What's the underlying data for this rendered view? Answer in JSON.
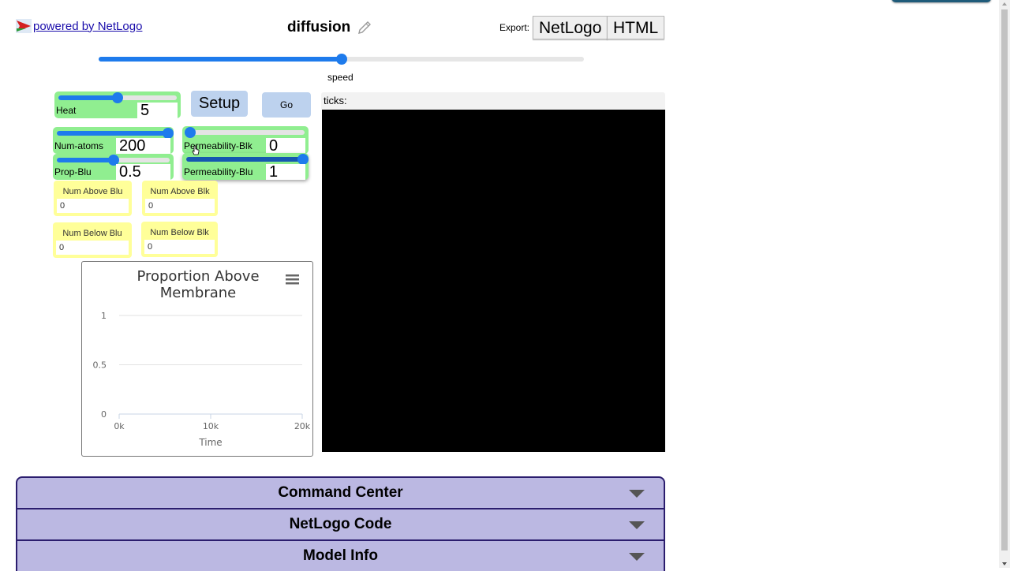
{
  "header": {
    "powered_by": "powered by NetLogo",
    "model_title": "diffusion",
    "export_label": "Export:",
    "export_buttons": [
      "NetLogo",
      "HTML"
    ]
  },
  "speed": {
    "label": "speed",
    "value_fraction": 0.5
  },
  "buttons": {
    "setup": "Setup",
    "go": "Go"
  },
  "sliders": {
    "heat": {
      "label": "Heat",
      "value": "5",
      "fraction": 0.5
    },
    "num_atoms": {
      "label": "Num-atoms",
      "value": "200",
      "fraction": 1.0
    },
    "prop_blu": {
      "label": "Prop-Blu",
      "value": "0.5",
      "fraction": 0.5
    },
    "permeability_blk": {
      "label": "Permeability-Blk",
      "value": "0",
      "fraction": 0.0
    },
    "permeability_blu": {
      "label": "Permeability-Blu",
      "value": "1",
      "fraction": 1.0
    }
  },
  "monitors": [
    {
      "label": "Num Above Blu",
      "value": "0"
    },
    {
      "label": "Num Above Blk",
      "value": "0"
    },
    {
      "label": "Num Below Blu",
      "value": "0"
    },
    {
      "label": "Num Below Blk",
      "value": "0"
    }
  ],
  "view": {
    "ticks_label": "ticks:",
    "background": "#000000"
  },
  "chart_data": {
    "type": "line",
    "title_lines": [
      "Proportion Above",
      "Membrane"
    ],
    "xlabel": "Time",
    "ylabel": "",
    "x_ticks": [
      "0k",
      "10k",
      "20k"
    ],
    "y_ticks": [
      "0",
      "0.5",
      "1"
    ],
    "xlim": [
      0,
      20000
    ],
    "ylim": [
      0,
      1
    ],
    "grid": true,
    "series": []
  },
  "tabs": [
    "Command Center",
    "NetLogo Code",
    "Model Info"
  ],
  "colors": {
    "slider_bg": "#90ee90",
    "slider_accent": "#1e7bec",
    "button_bg": "#bdd2ee",
    "monitor_bg": "#ffff99",
    "tab_bg": "#bbb8e2",
    "tab_border": "#2b1d6e"
  }
}
